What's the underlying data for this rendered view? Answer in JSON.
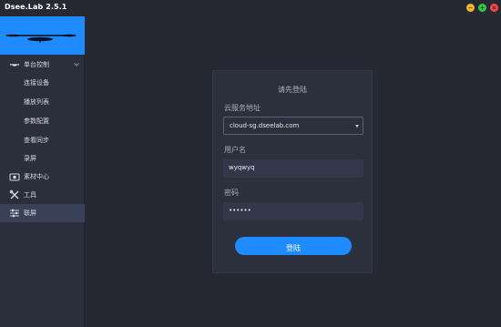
{
  "app": {
    "title": "Dsee.Lab 2.5.1"
  },
  "window_controls": {
    "minimize_color": "#f5b82a",
    "maximize_color": "#31c84c",
    "close_color": "#ee4c4c"
  },
  "sidebar": {
    "banner_color": "#1e8bff",
    "items": [
      {
        "label": "单台控制",
        "icon": "drone-icon",
        "expanded": true
      },
      {
        "label": "连接设备"
      },
      {
        "label": "播放列表"
      },
      {
        "label": "参数配置"
      },
      {
        "label": "查看同步"
      },
      {
        "label": "录屏"
      },
      {
        "label": "素材中心",
        "icon": "media-icon"
      },
      {
        "label": "工具",
        "icon": "tools-icon"
      },
      {
        "label": "联屏",
        "icon": "sliders-icon",
        "active": true
      }
    ]
  },
  "login": {
    "title": "请先登陆",
    "server_label": "云服务地址",
    "server_value": "cloud-sg.dseelab.com",
    "username_label": "用户名",
    "username_value": "wyqwyq",
    "password_label": "密码",
    "password_value": "••••••",
    "submit_label": "登陆"
  },
  "colors": {
    "accent": "#1e8bff",
    "background": "#262833",
    "sidebar": "#2b2e3b",
    "active_item": "#3a4056"
  }
}
